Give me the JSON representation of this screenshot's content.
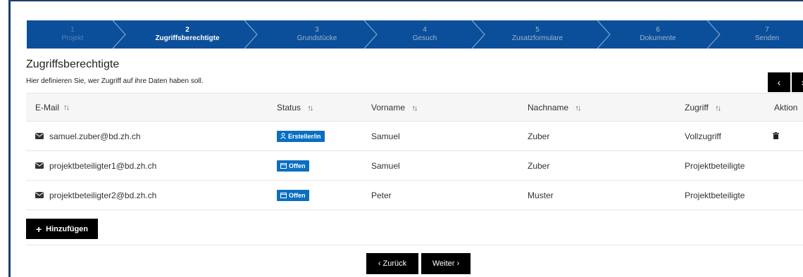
{
  "stepper": {
    "steps": [
      {
        "num": "1",
        "label": "Projekt"
      },
      {
        "num": "2",
        "label": "Zugriffsberechtigte"
      },
      {
        "num": "3",
        "label": "Grundstücke"
      },
      {
        "num": "4",
        "label": "Gesuch"
      },
      {
        "num": "5",
        "label": "Zusatzformulare"
      },
      {
        "num": "6",
        "label": "Dokumente"
      },
      {
        "num": "7",
        "label": "Senden"
      }
    ],
    "active_index": 2
  },
  "page": {
    "title": "Zugriffsberechtigte",
    "subtitle": "Hier definieren Sie, wer Zugriff auf ihre Daten haben soll.",
    "prev_icon": "‹",
    "next_icon": "›"
  },
  "table": {
    "headers": {
      "email": "E-Mail",
      "status": "Status",
      "vorname": "Vorname",
      "nachname": "Nachname",
      "zugriff": "Zugriff",
      "aktion": "Aktion"
    },
    "sort_glyph": "↑↓",
    "rows": [
      {
        "email": "samuel.zuber@bd.zh.ch",
        "status": "Ersteller/in",
        "vorname": "Samuel",
        "nachname": "Zuber",
        "zugriff": "Vollzugriff"
      },
      {
        "email": "projektbeteiligter1@bd.zh.ch",
        "status": "Offen",
        "vorname": "Samuel",
        "nachname": "Zuber",
        "zugriff": "Projektbeteiligte"
      },
      {
        "email": "projektbeteiligter2@bd.zh.ch",
        "status": "Offen",
        "vorname": "Peter",
        "nachname": "Muster",
        "zugriff": "Projektbeteiligte"
      }
    ]
  },
  "actions": {
    "add_label": "Hinzufügen",
    "back_label": "‹ Zurück",
    "next_label": "Weiter ›"
  },
  "colors": {
    "stepper_bg": "#0b4f9a",
    "badge_bg": "#0a6fc2",
    "button_bg": "#000000"
  }
}
